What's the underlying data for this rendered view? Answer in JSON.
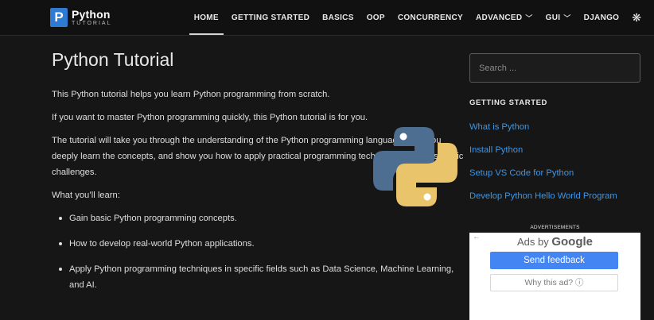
{
  "header": {
    "logo_letter": "P",
    "logo_title": "Python",
    "logo_subtitle": "TUTORIAL",
    "nav": [
      {
        "label": "HOME"
      },
      {
        "label": "GETTING STARTED"
      },
      {
        "label": "BASICS"
      },
      {
        "label": "OOP"
      },
      {
        "label": "CONCURRENCY"
      },
      {
        "label": "ADVANCED"
      },
      {
        "label": "GUI"
      },
      {
        "label": "DJANGO"
      }
    ],
    "active_item": "HOME",
    "theme_icon": "gear-icon"
  },
  "main": {
    "title": "Python Tutorial",
    "paragraphs": [
      "This Python tutorial helps you learn Python programming from scratch.",
      "If you want to master Python programming quickly, this Python tutorial is for you.",
      "The tutorial will take you through the understanding of the Python programming language, help you deeply learn the concepts, and show you how to apply practical programming techniques to your specific challenges.",
      "What you’ll learn:"
    ],
    "bullets": [
      "Gain basic Python programming concepts.",
      "How to develop real-world Python applications.",
      "Apply Python programming techniques in specific fields such as Data Science, Machine Learning, and AI."
    ],
    "logo_colors": {
      "blue": "#4d6e91",
      "yellow": "#e9c46a"
    }
  },
  "sidebar": {
    "search_placeholder": "Search ...",
    "heading": "GETTING STARTED",
    "links": [
      "What is Python",
      "Install Python",
      "Setup VS Code for Python",
      "Develop Python Hello World Program"
    ],
    "link_color": "#3e96e6",
    "ad_label": "ADVERTISEMENTS",
    "ad": {
      "ads_by": "Ads by",
      "brand": "Google",
      "feedback": "Send feedback",
      "why": "Why this ad? ⓘ"
    }
  }
}
